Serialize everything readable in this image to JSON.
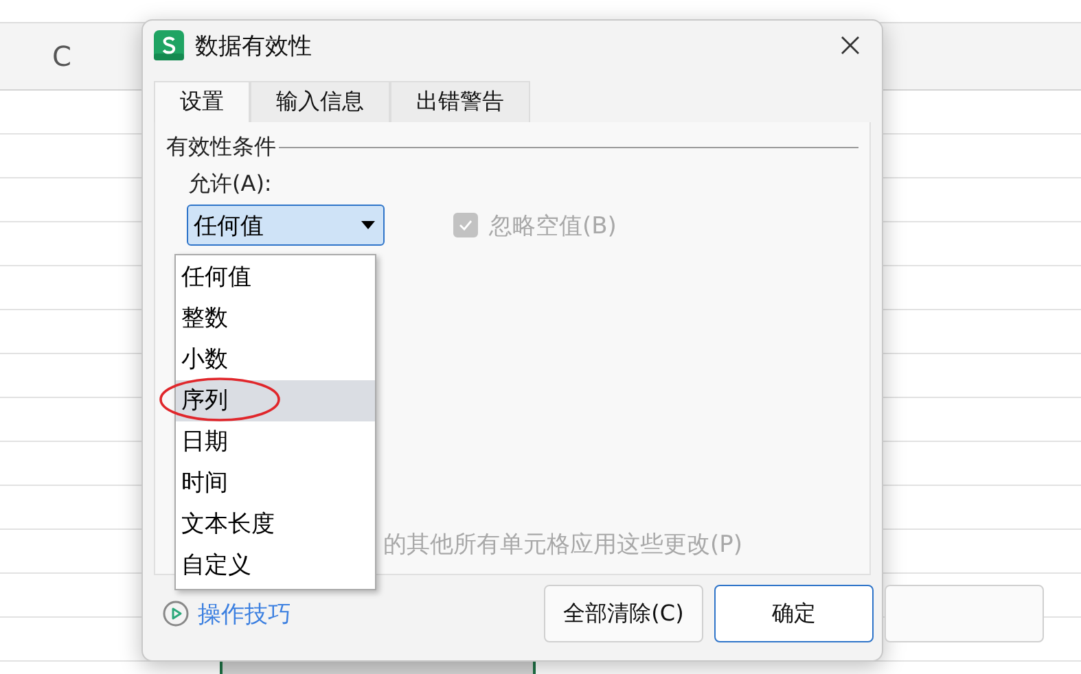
{
  "spreadsheet": {
    "column_header": "C"
  },
  "dialog": {
    "title": "数据有效性",
    "tabs": [
      {
        "label": "设置",
        "selected": true
      },
      {
        "label": "输入信息",
        "selected": false
      },
      {
        "label": "出错警告",
        "selected": false
      }
    ],
    "section_title": "有效性条件",
    "allow_label": "允许(A):",
    "allow_value": "任何值",
    "ignore_blank": {
      "label": "忽略空值(B)",
      "checked": true,
      "disabled": true
    },
    "apply_note": "的其他所有单元格应用这些更改(P)",
    "dropdown_options": [
      {
        "label": "任何值",
        "selected": false,
        "circled": false
      },
      {
        "label": "整数",
        "selected": false,
        "circled": false
      },
      {
        "label": "小数",
        "selected": false,
        "circled": false
      },
      {
        "label": "序列",
        "selected": true,
        "circled": true
      },
      {
        "label": "日期",
        "selected": false,
        "circled": false
      },
      {
        "label": "时间",
        "selected": false,
        "circled": false
      },
      {
        "label": "文本长度",
        "selected": false,
        "circled": false
      },
      {
        "label": "自定义",
        "selected": false,
        "circled": false
      }
    ],
    "tips_link": "操作技巧",
    "buttons": [
      {
        "label": "全部清除(C)",
        "kind": "normal"
      },
      {
        "label": "确定",
        "kind": "primary"
      },
      {
        "kind": "normal"
      }
    ]
  }
}
